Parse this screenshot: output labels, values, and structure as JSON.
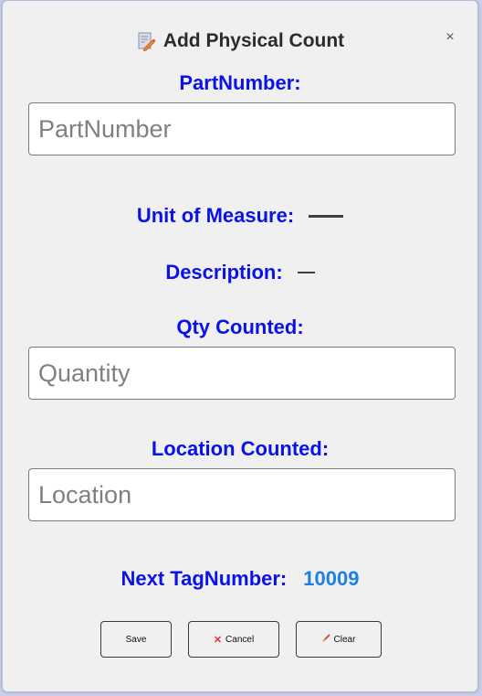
{
  "dialog": {
    "title": "Add Physical Count",
    "title_icon": "edit-document-icon",
    "close_glyph": "×"
  },
  "part_number": {
    "label": "PartNumber:",
    "value": "",
    "placeholder": "PartNumber"
  },
  "unit_of_measure": {
    "label": "Unit of Measure:",
    "value_display": "dash"
  },
  "description": {
    "label": "Description:",
    "value_display": "dash"
  },
  "qty_counted": {
    "label": "Qty Counted:",
    "value": "",
    "placeholder": "Quantity"
  },
  "location_counted": {
    "label": "Location Counted:",
    "value": "",
    "placeholder": "Location"
  },
  "next_tag": {
    "label": "Next TagNumber:",
    "value": "10009"
  },
  "buttons": {
    "save": {
      "label": "Save"
    },
    "cancel": {
      "label": "Cancel",
      "icon": "x-icon"
    },
    "clear": {
      "label": "Clear",
      "icon": "eraser-icon"
    }
  },
  "colors": {
    "label_blue": "#0a12e8",
    "tag_value_blue": "#1e7fe0",
    "dialog_bg": "#f0f0f0",
    "cancel_icon_red": "#e0342e"
  }
}
